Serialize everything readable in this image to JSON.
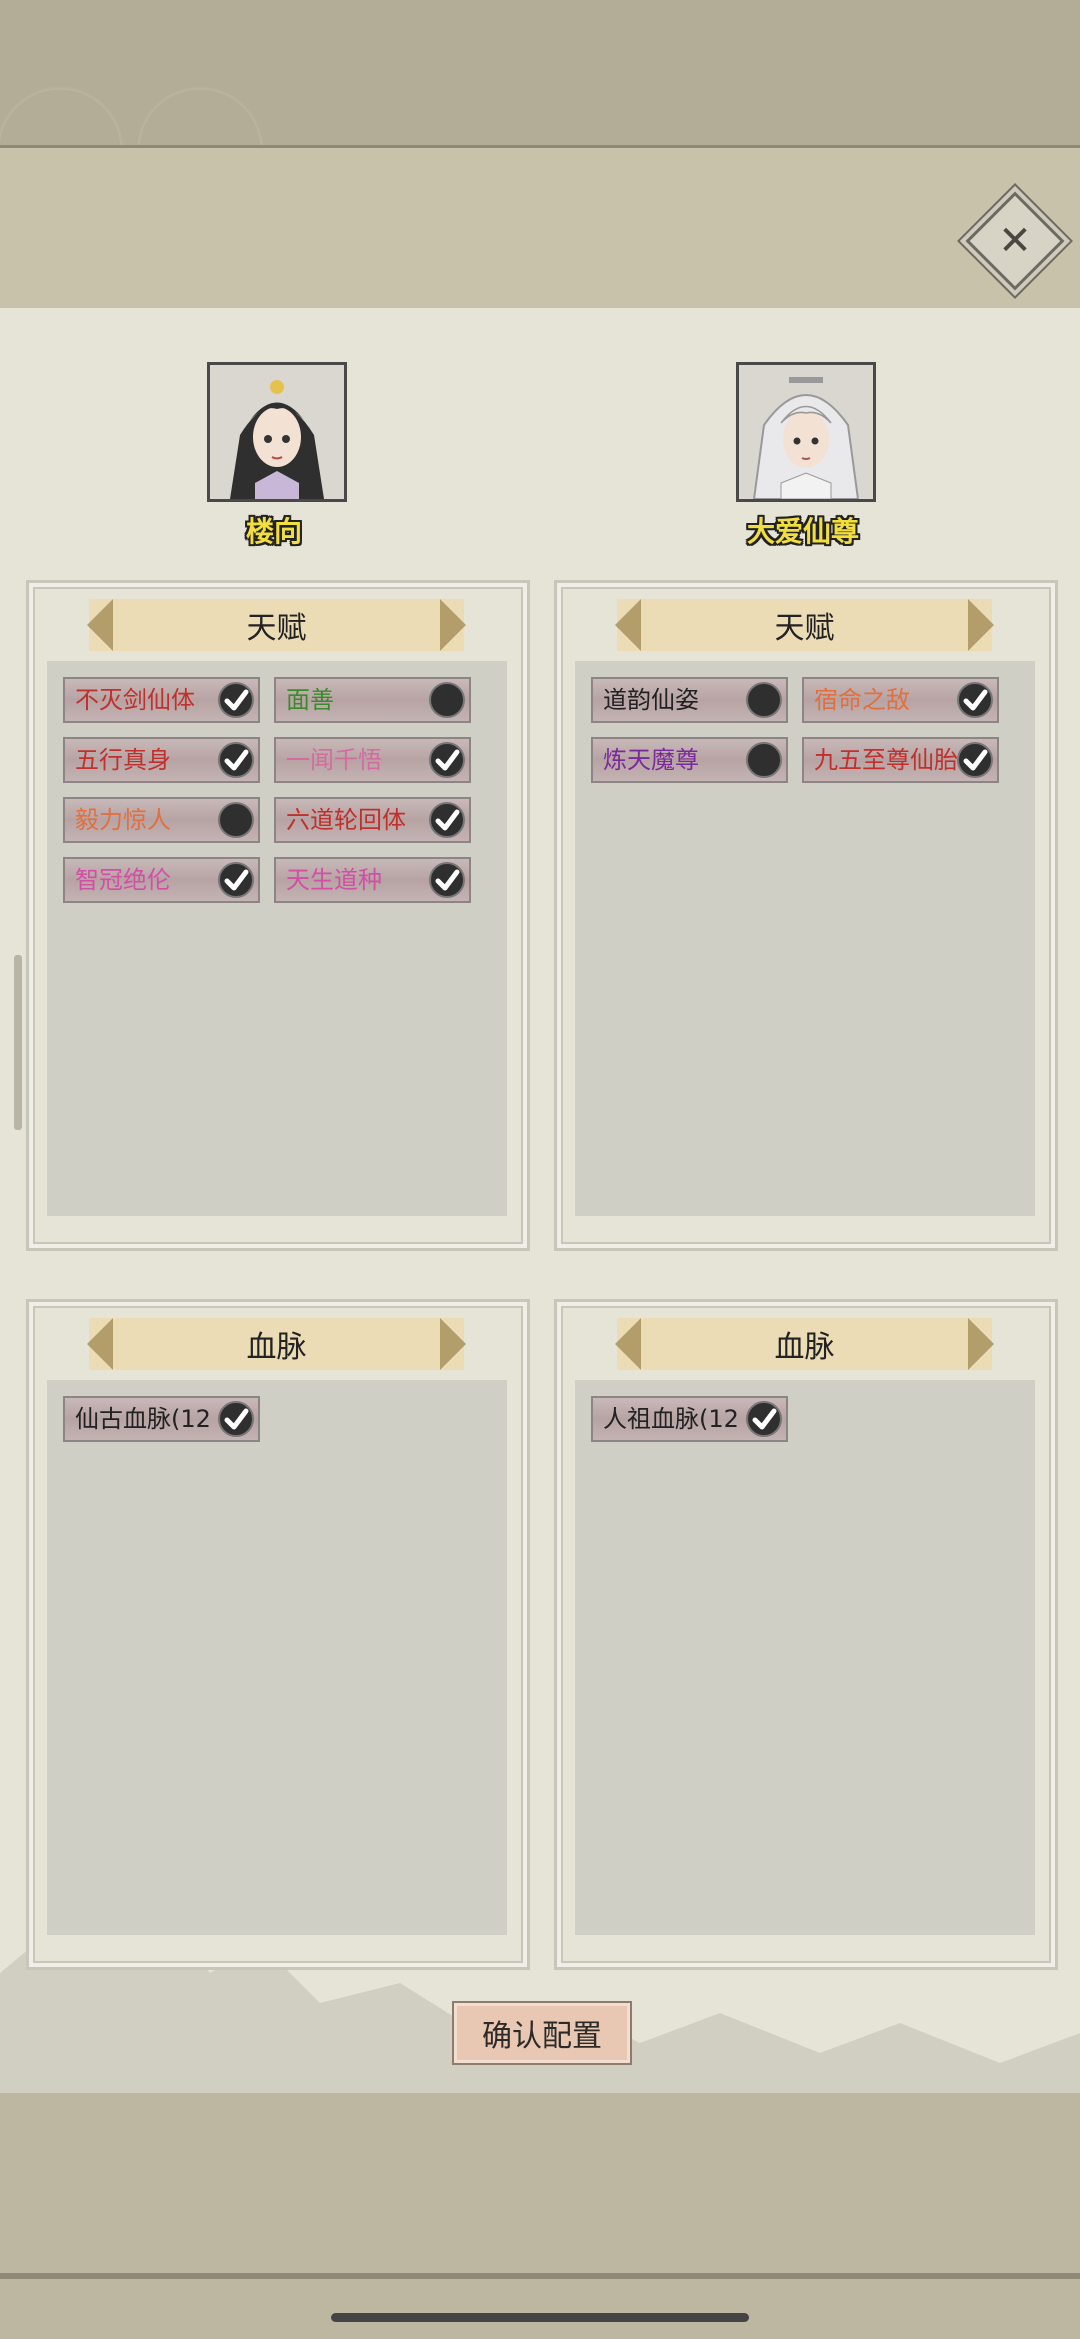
{
  "characters": [
    {
      "name": "楼向"
    },
    {
      "name": "大爱仙尊"
    }
  ],
  "close_icon": "close-icon",
  "panels": {
    "talent_title": "天赋",
    "bloodline_title": "血脉"
  },
  "talents_left": [
    {
      "label": "不灭剑仙体",
      "color": "#c0302c",
      "checked": true
    },
    {
      "label": "面善",
      "color": "#3c8a2e",
      "checked": false
    },
    {
      "label": "五行真身",
      "color": "#c0302c",
      "checked": true
    },
    {
      "label": "一闻千悟",
      "color": "#d46ca0",
      "checked": true
    },
    {
      "label": "毅力惊人",
      "color": "#e07040",
      "checked": false
    },
    {
      "label": "六道轮回体",
      "color": "#c0302c",
      "checked": true
    },
    {
      "label": "智冠绝伦",
      "color": "#d24fa6",
      "checked": true
    },
    {
      "label": "天生道种",
      "color": "#d24fa6",
      "checked": true
    }
  ],
  "talents_right": [
    {
      "label": "道韵仙姿",
      "color": "#222222",
      "checked": false
    },
    {
      "label": "宿命之敌",
      "color": "#e07040",
      "checked": true
    },
    {
      "label": "炼天魔尊",
      "color": "#7a2a9a",
      "checked": false
    },
    {
      "label": "九五至尊仙胎",
      "color": "#c0302c",
      "checked": true
    }
  ],
  "bloodline_left": [
    {
      "label": "仙古血脉(12",
      "color": "#222222",
      "checked": true
    }
  ],
  "bloodline_right": [
    {
      "label": "人祖血脉(12",
      "color": "#222222",
      "checked": true
    }
  ],
  "confirm_label": "确认配置"
}
